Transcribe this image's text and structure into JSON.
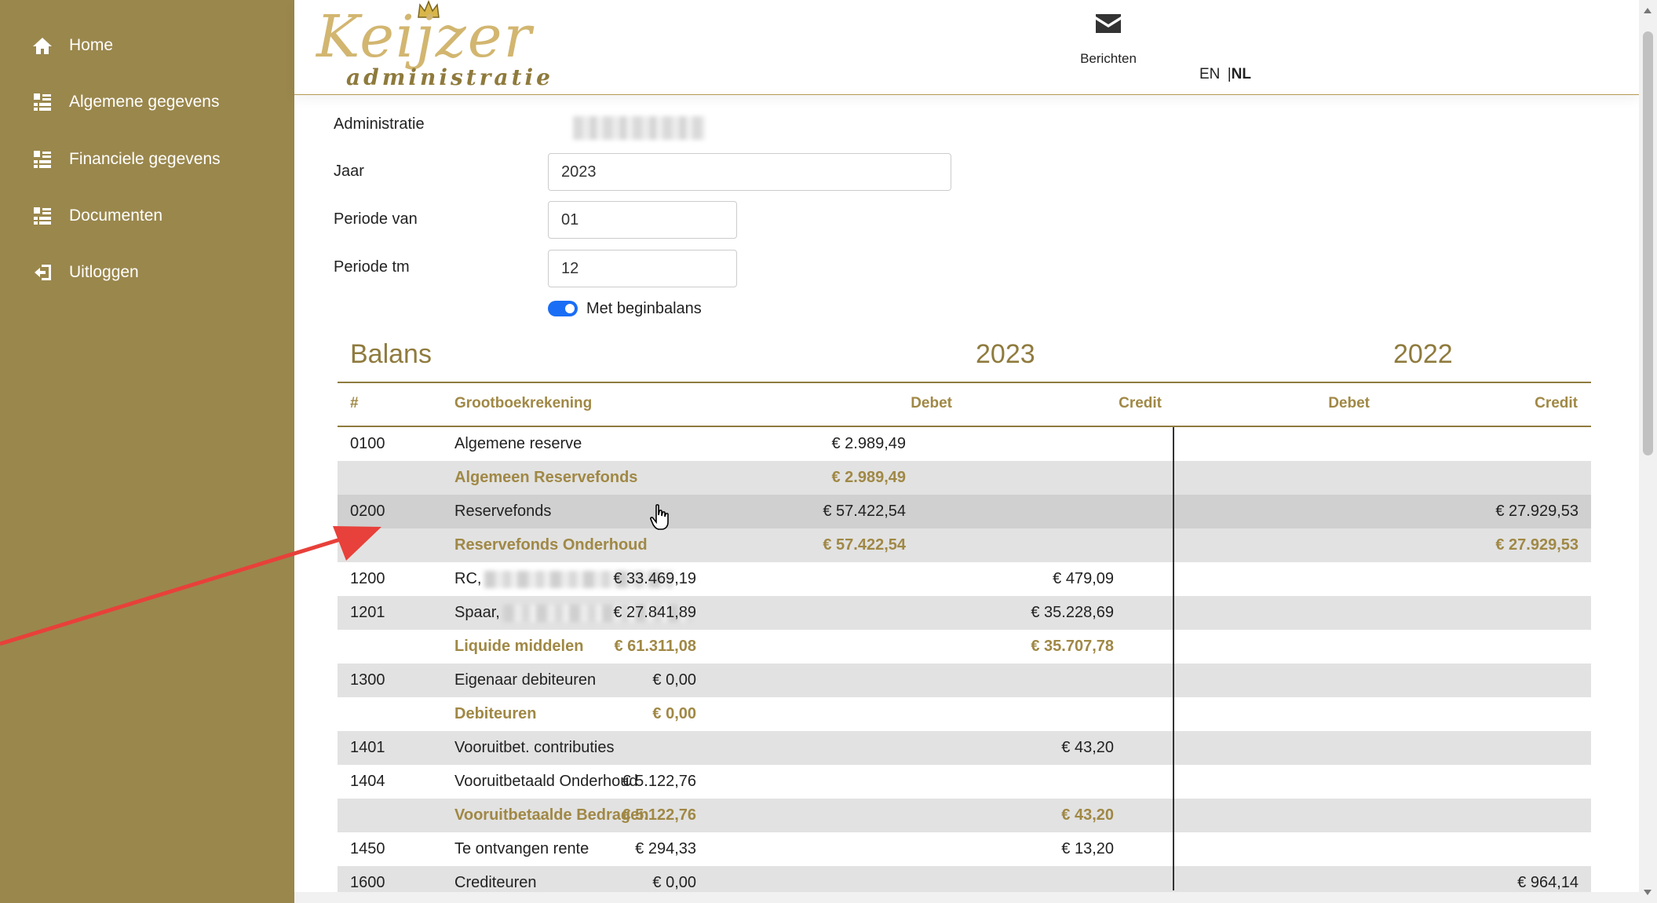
{
  "sidebar": {
    "items": [
      {
        "label": "Home",
        "icon": "home-icon"
      },
      {
        "label": "Algemene gegevens",
        "icon": "list-icon"
      },
      {
        "label": "Financiele gegevens",
        "icon": "list-icon"
      },
      {
        "label": "Documenten",
        "icon": "list-icon"
      },
      {
        "label": "Uitloggen",
        "icon": "logout-icon"
      }
    ],
    "color": "#9a874c"
  },
  "header": {
    "logo_text": "Keijzer",
    "logo_sub": "administratie",
    "messages_label": "Berichten",
    "lang_en": "EN",
    "lang_sep": "|",
    "lang_nl": "NL"
  },
  "form": {
    "administratie_label": "Administratie",
    "jaar_label": "Jaar",
    "jaar_value": "2023",
    "periode_van_label": "Periode van",
    "periode_van_value": "01",
    "periode_tm_label": "Periode tm",
    "periode_tm_value": "12",
    "toggle_label": "Met beginbalans",
    "toggle_on": true
  },
  "table": {
    "title": "Balans",
    "year_current": "2023",
    "year_previous": "2022",
    "headers": {
      "num": "#",
      "account": "Grootboekrekening",
      "debet_2023": "Debet",
      "credit_2023": "Credit",
      "debet_2022": "Debet",
      "credit_2022": "Credit"
    },
    "rows": [
      {
        "num": "0100",
        "name": "Algemene reserve",
        "d23": "",
        "c23": "€ 2.989,49",
        "d22": "",
        "c22": "",
        "subtotal": false
      },
      {
        "num": "",
        "name": "Algemeen Reservefonds",
        "d23": "",
        "c23": "€ 2.989,49",
        "d22": "",
        "c22": "",
        "subtotal": true
      },
      {
        "num": "0200",
        "name": "Reservefonds",
        "d23": "",
        "c23": "€ 57.422,54",
        "d22": "",
        "c22": "€ 27.929,53",
        "subtotal": false
      },
      {
        "num": "",
        "name": "Reservefonds Onderhoud",
        "d23": "",
        "c23": "€ 57.422,54",
        "d22": "",
        "c22": "€ 27.929,53",
        "subtotal": true
      },
      {
        "num": "1200",
        "name": "RC,",
        "d23": "€ 33.469,19",
        "c23": "",
        "d22": "€ 479,09",
        "c22": "",
        "subtotal": false
      },
      {
        "num": "1201",
        "name": "Spaar,",
        "d23": "€ 27.841,89",
        "c23": "",
        "d22": "€ 35.228,69",
        "c22": "",
        "subtotal": false
      },
      {
        "num": "",
        "name": "Liquide middelen",
        "d23": "€ 61.311,08",
        "c23": "",
        "d22": "€ 35.707,78",
        "c22": "",
        "subtotal": true
      },
      {
        "num": "1300",
        "name": "Eigenaar debiteuren",
        "d23": "€ 0,00",
        "c23": "",
        "d22": "",
        "c22": "",
        "subtotal": false
      },
      {
        "num": "",
        "name": "Debiteuren",
        "d23": "€ 0,00",
        "c23": "",
        "d22": "",
        "c22": "",
        "subtotal": true
      },
      {
        "num": "1401",
        "name": "Vooruitbet. contributies",
        "d23": "",
        "c23": "",
        "d22": "€ 43,20",
        "c22": "",
        "subtotal": false
      },
      {
        "num": "1404",
        "name": "Vooruitbetaald Onderhoud",
        "d23": "€ 5.122,76",
        "c23": "",
        "d22": "",
        "c22": "",
        "subtotal": false
      },
      {
        "num": "",
        "name": "Vooruitbetaalde Bedragen",
        "d23": "€ 5.122,76",
        "c23": "",
        "d22": "€ 43,20",
        "c22": "",
        "subtotal": true
      },
      {
        "num": "1450",
        "name": "Te ontvangen rente",
        "d23": "€ 294,33",
        "c23": "",
        "d22": "€ 13,20",
        "c22": "",
        "subtotal": false
      },
      {
        "num": "1600",
        "name": "Crediteuren",
        "d23": "€ 0,00",
        "c23": "",
        "d22": "",
        "c22": "€ 964,14",
        "subtotal": false
      }
    ]
  },
  "colors": {
    "accent": "#9a874c",
    "heading": "#8f7b3e",
    "subtotal": "#a08845",
    "toggle": "#1a6ef5",
    "annotation_arrow": "#e8403a"
  }
}
